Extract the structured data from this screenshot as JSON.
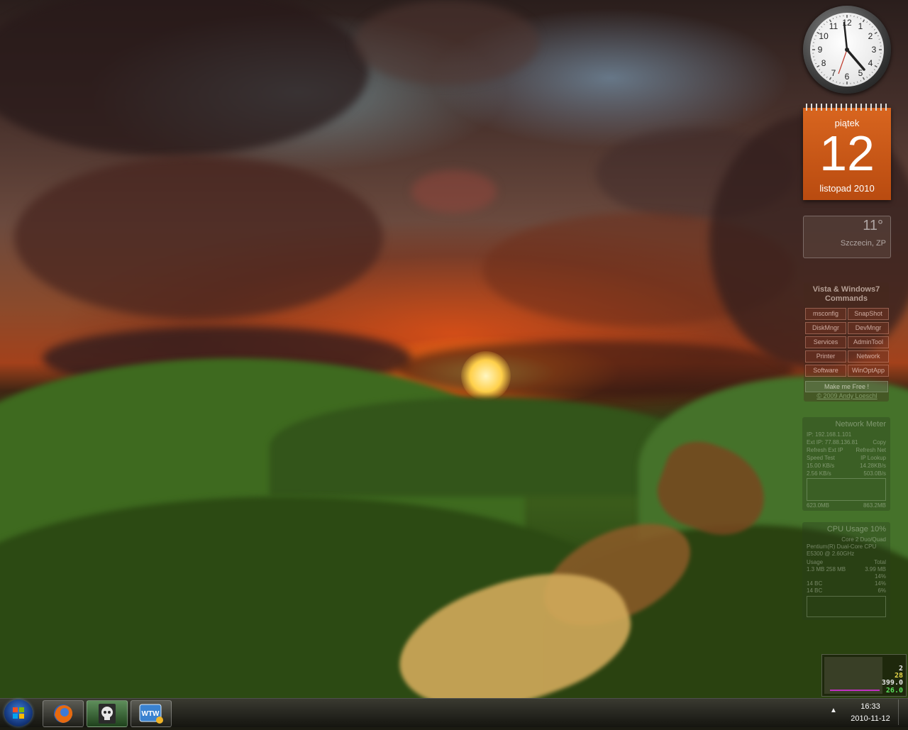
{
  "gadgets": {
    "calendar": {
      "day_name": "piątek",
      "day_number": "12",
      "month_year": "listopad 2010"
    },
    "clock": {
      "numerals": [
        "12",
        "1",
        "2",
        "3",
        "4",
        "5",
        "6",
        "7",
        "8",
        "9",
        "10",
        "11"
      ]
    },
    "weather": {
      "temperature": "11°",
      "location": "Szczecin, ZP"
    },
    "commands": {
      "title": "Vista & Windows7 Commands",
      "buttons": [
        "msconfig",
        "SnapShot",
        "DiskMngr",
        "DevMngr",
        "Services",
        "AdminTool",
        "Printer",
        "Network",
        "Software",
        "WinOptApp"
      ],
      "free_button": "Make me Free !",
      "copyright": "© 2009 Andy Loeschl"
    },
    "network_meter": {
      "title": "Network Meter",
      "rows": [
        {
          "left": "IP: 192.168.1.101",
          "right": ""
        },
        {
          "left": "Ext IP: 77.88.136.81",
          "right": "Copy"
        },
        {
          "left": "Refresh Ext IP",
          "right": "Refresh Net"
        },
        {
          "left": "Speed Test",
          "right": "IP Lookup"
        },
        {
          "left": "15.00 KB/s",
          "right": "14.28KB/s"
        },
        {
          "left": "2.56 KB/s",
          "right": "503.0B/s"
        }
      ],
      "totals": [
        "623.0MB",
        "863.2MB"
      ]
    },
    "cpu": {
      "title": "CPU Usage  10%",
      "rows": [
        {
          "left": "",
          "right": "Core 2 Duo/Quad"
        },
        {
          "left": "Pentium(R) Dual-Core CPU",
          "right": ""
        },
        {
          "left": "E5300 @ 2.60GHz",
          "right": ""
        },
        {
          "left": "Usage",
          "right": "Total"
        },
        {
          "left": "1.3 MB   258 MB",
          "right": "3.99 MB"
        },
        {
          "left": "",
          "right": "14%"
        },
        {
          "left": "14 BC",
          "right": "14%"
        },
        {
          "left": "14 BC",
          "right": "6%"
        }
      ]
    },
    "mini_meter": {
      "values": [
        "2",
        "28",
        "399.0",
        "26.0"
      ]
    }
  },
  "taskbar": {
    "apps": [
      "Firefox",
      "Security app",
      "WTW"
    ],
    "wtw_label": "WTW",
    "time": "16:33",
    "date": "2010-11-12"
  }
}
